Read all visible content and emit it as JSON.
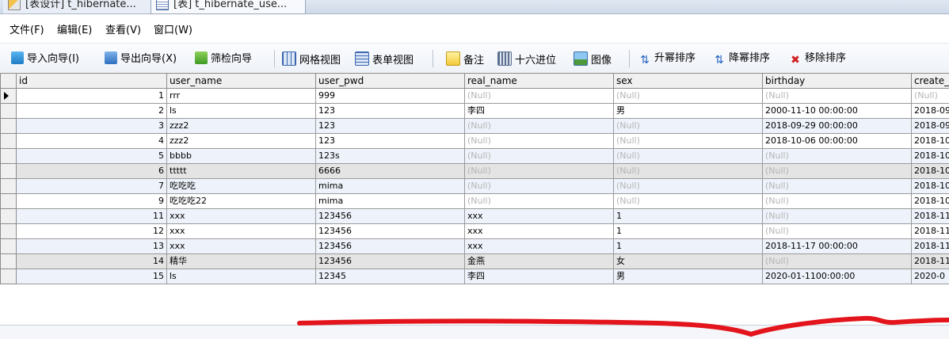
{
  "tabs": [
    {
      "label": "[表设计] t_hibernate..."
    },
    {
      "label": "[表] t_hibernate_use..."
    }
  ],
  "menu": [
    "文件(F)",
    "编辑(E)",
    "查看(V)",
    "窗口(W)"
  ],
  "toolbar": {
    "import": "导入向导(I)",
    "export": "导出向导(X)",
    "filter": "筛检向导",
    "grid_view": "网格视图",
    "form_view": "表单视图",
    "memo": "备注",
    "hex": "十六进位",
    "image": "图像",
    "sort_asc": "升幂排序",
    "sort_desc": "降幂排序",
    "remove_sort": "移除排序"
  },
  "columns": [
    "id",
    "user_name",
    "user_pwd",
    "real_name",
    "sex",
    "birthday",
    "create_"
  ],
  "rows": [
    [
      "1",
      "rrr",
      "999",
      "(Null)",
      "(Null)",
      "(Null)",
      "(Null)"
    ],
    [
      "2",
      "ls",
      "123",
      "李四",
      "男",
      "2000-11-10 00:00:00",
      "2018-09"
    ],
    [
      "3",
      "zzz2",
      "123",
      "(Null)",
      "(Null)",
      "2018-09-29 00:00:00",
      "2018-09"
    ],
    [
      "4",
      "zzz2",
      "123",
      "(Null)",
      "(Null)",
      "2018-10-06 00:00:00",
      "2018-10"
    ],
    [
      "5",
      "bbbb",
      "123s",
      "(Null)",
      "(Null)",
      "(Null)",
      "2018-10"
    ],
    [
      "6",
      "ttttt",
      "6666",
      "(Null)",
      "(Null)",
      "(Null)",
      "2018-10"
    ],
    [
      "7",
      "吃吃吃",
      "mima",
      "(Null)",
      "(Null)",
      "(Null)",
      "2018-10"
    ],
    [
      "9",
      "吃吃吃22",
      "mima",
      "(Null)",
      "(Null)",
      "(Null)",
      "2018-10"
    ],
    [
      "11",
      "xxx",
      "123456",
      "xxx",
      "1",
      "(Null)",
      "2018-11"
    ],
    [
      "12",
      "xxx",
      "123456",
      "xxx",
      "1",
      "(Null)",
      "2018-11"
    ],
    [
      "13",
      "xxx",
      "123456",
      "xxx",
      "1",
      "2018-11-17 00:00:00",
      "2018-11"
    ],
    [
      "14",
      "精华",
      "123456",
      "金燕",
      "女",
      "(Null)",
      "2018-11"
    ],
    [
      "15",
      "ls",
      "12345",
      "李四",
      "男",
      "2020-01-1100:00:00",
      "2020-0"
    ]
  ],
  "colors": {
    "row_alt": "#eef3fb",
    "row_current": "#e4e4e4",
    "null_text": "#b4b4b4",
    "annotation": "#e3141b"
  }
}
